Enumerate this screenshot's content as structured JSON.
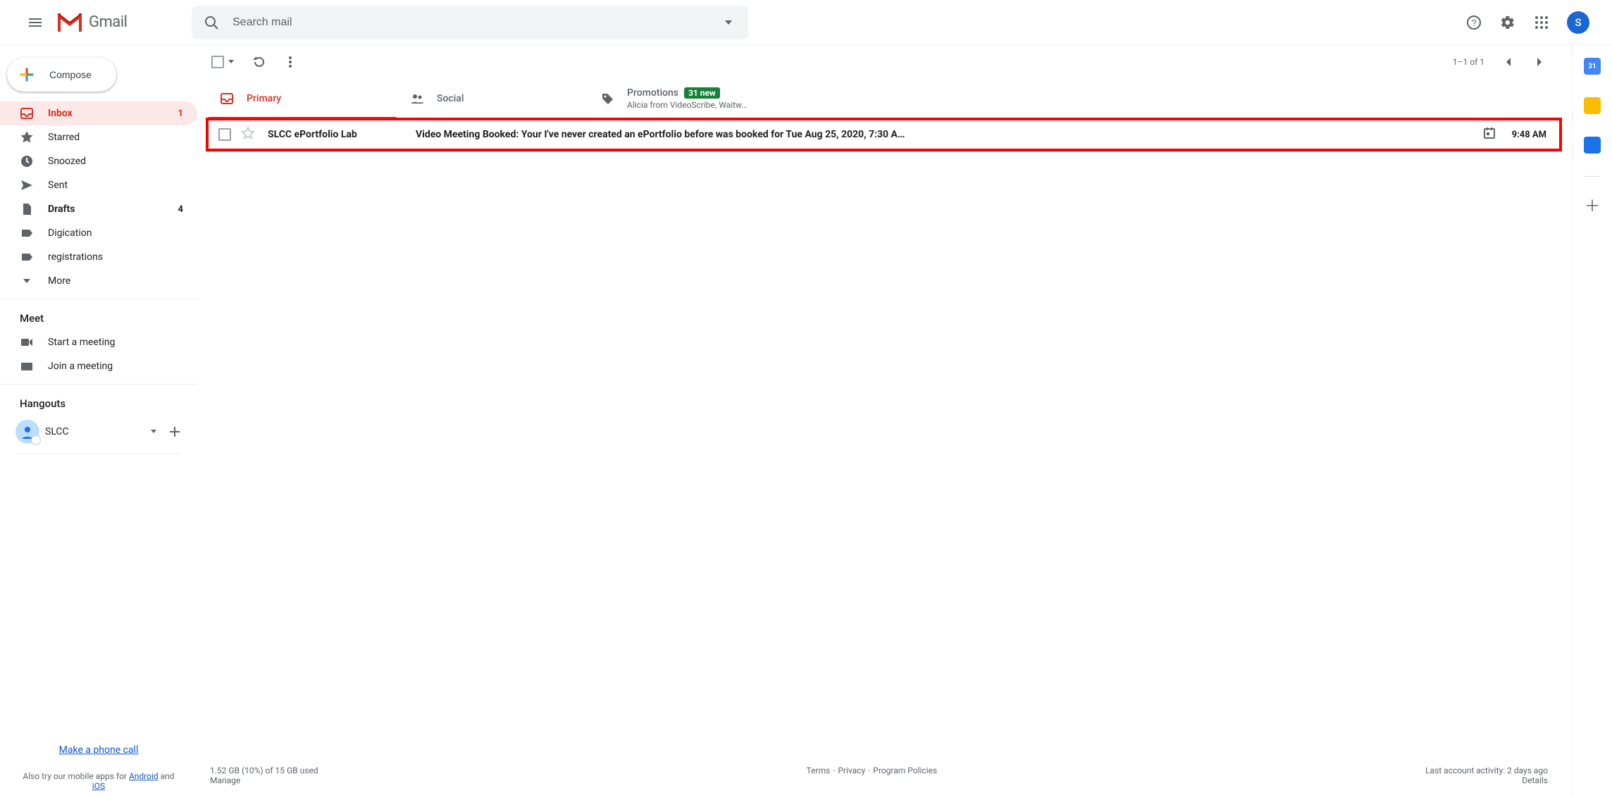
{
  "header": {
    "product_name": "Gmail",
    "search_placeholder": "Search mail",
    "avatar_letter": "S"
  },
  "sidebar": {
    "compose_label": "Compose",
    "nav": [
      {
        "id": "inbox",
        "label": "Inbox",
        "count": "1",
        "active": true
      },
      {
        "id": "starred",
        "label": "Starred",
        "count": ""
      },
      {
        "id": "snoozed",
        "label": "Snoozed",
        "count": ""
      },
      {
        "id": "sent",
        "label": "Sent",
        "count": ""
      },
      {
        "id": "drafts",
        "label": "Drafts",
        "count": "4",
        "bold": true
      },
      {
        "id": "label-digication",
        "label": "Digication",
        "count": ""
      },
      {
        "id": "label-registrations",
        "label": "registrations",
        "count": ""
      },
      {
        "id": "more",
        "label": "More",
        "count": ""
      }
    ],
    "meet_title": "Meet",
    "meet_start": "Start a meeting",
    "meet_join": "Join a meeting",
    "hangouts_title": "Hangouts",
    "hangouts_name": "SLCC",
    "phone_link": "Make a phone call",
    "footer_pre": "Also try our mobile apps for ",
    "footer_android": "Android",
    "footer_and": " and ",
    "footer_ios": "iOS"
  },
  "toolbar": {
    "page_text": "1–1 of 1"
  },
  "tabs": {
    "primary": "Primary",
    "social": "Social",
    "promotions": "Promotions",
    "promotions_badge": "31 new",
    "promotions_sub": "Alicia from VideoScribe, Waitw…"
  },
  "emails": [
    {
      "sender": "SLCC ePortfolio Lab",
      "subject": "Video Meeting Booked: Your I've never created an ePortfolio before was booked for Tue Aug 25, 2020, 7:30 A…",
      "time": "9:48 AM"
    }
  ],
  "footer": {
    "storage_line": "1.52 GB (10%) of 15 GB used",
    "manage": "Manage",
    "terms": "Terms",
    "privacy": "Privacy",
    "policies": "Program Policies",
    "activity": "Last account activity: 2 days ago",
    "details": "Details"
  }
}
